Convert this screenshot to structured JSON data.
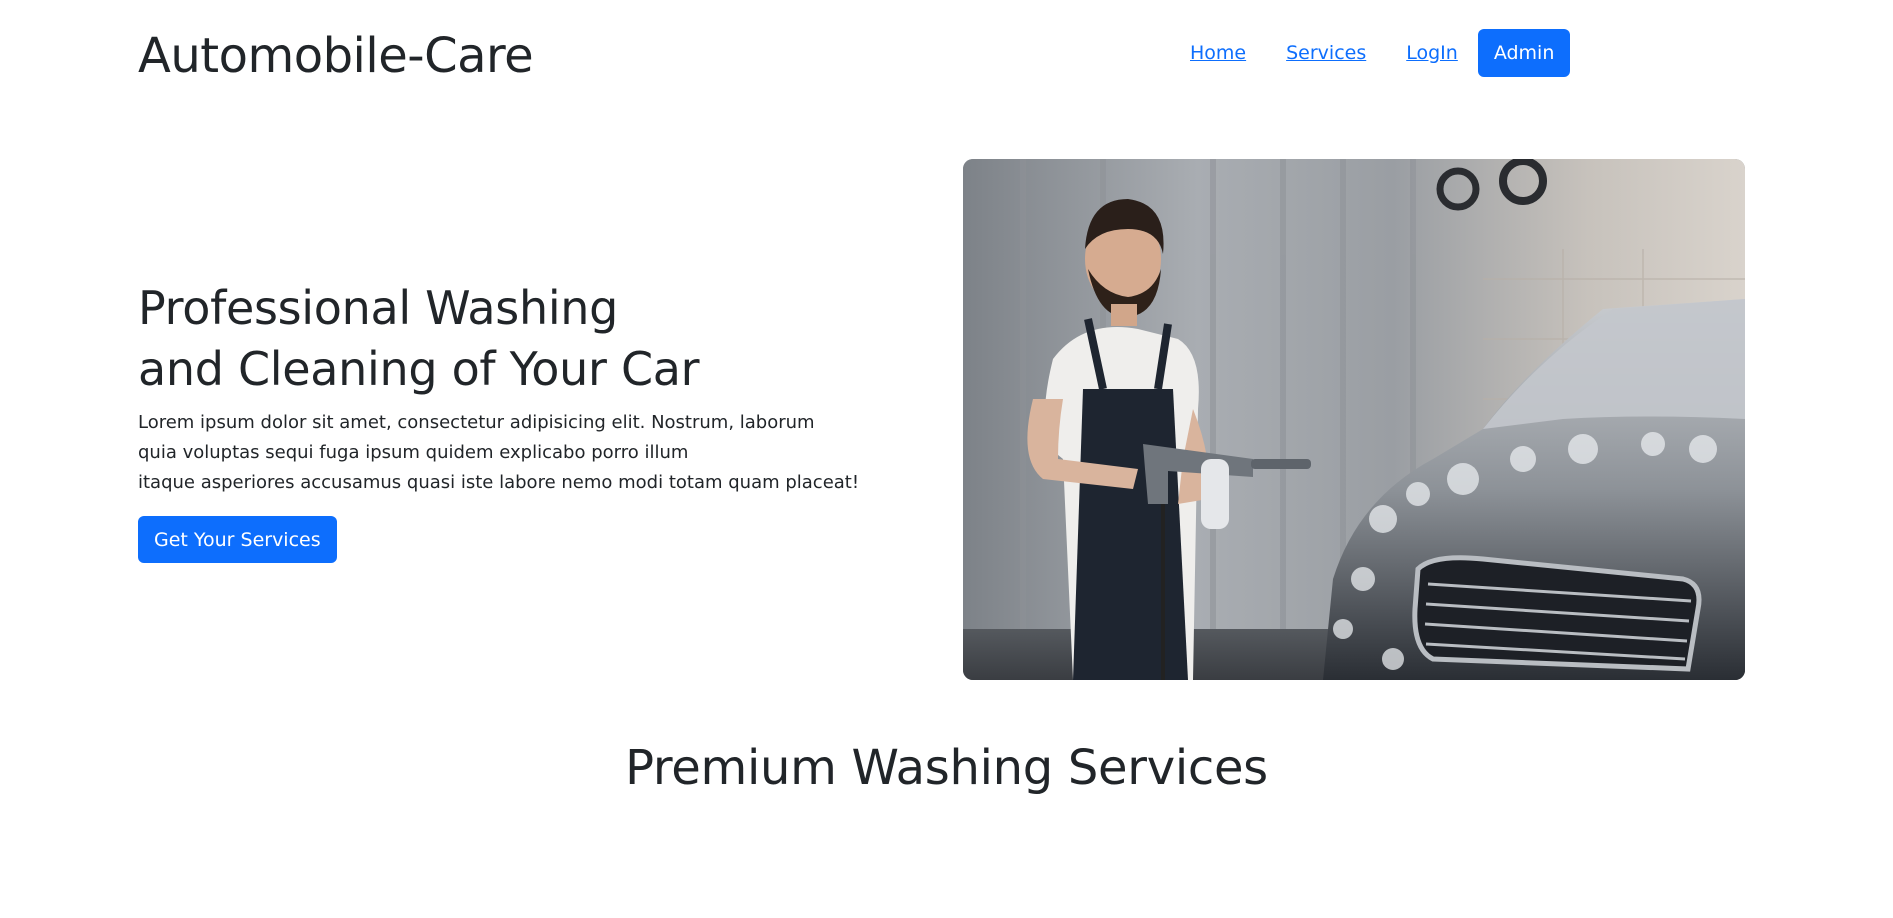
{
  "header": {
    "brand": "Automobile-Care",
    "nav": {
      "home": "Home",
      "services": "Services",
      "login": "LogIn",
      "admin": "Admin"
    }
  },
  "hero": {
    "title_line1": "Professional Washing",
    "title_line2": "and Cleaning of Your Car",
    "text_line1": "Lorem ipsum dolor sit amet, consectetur adipisicing elit. Nostrum, laborum",
    "text_line2": "quia voluptas sequi fuga ipsum quidem explicabo porro illum",
    "text_line3": "itaque asperiores accusamus quasi iste labore nemo modi totam quam placeat!",
    "cta": "Get Your Services"
  },
  "services": {
    "title": "Premium Washing Services"
  },
  "colors": {
    "primary": "#0d6efd",
    "text": "#212529"
  }
}
